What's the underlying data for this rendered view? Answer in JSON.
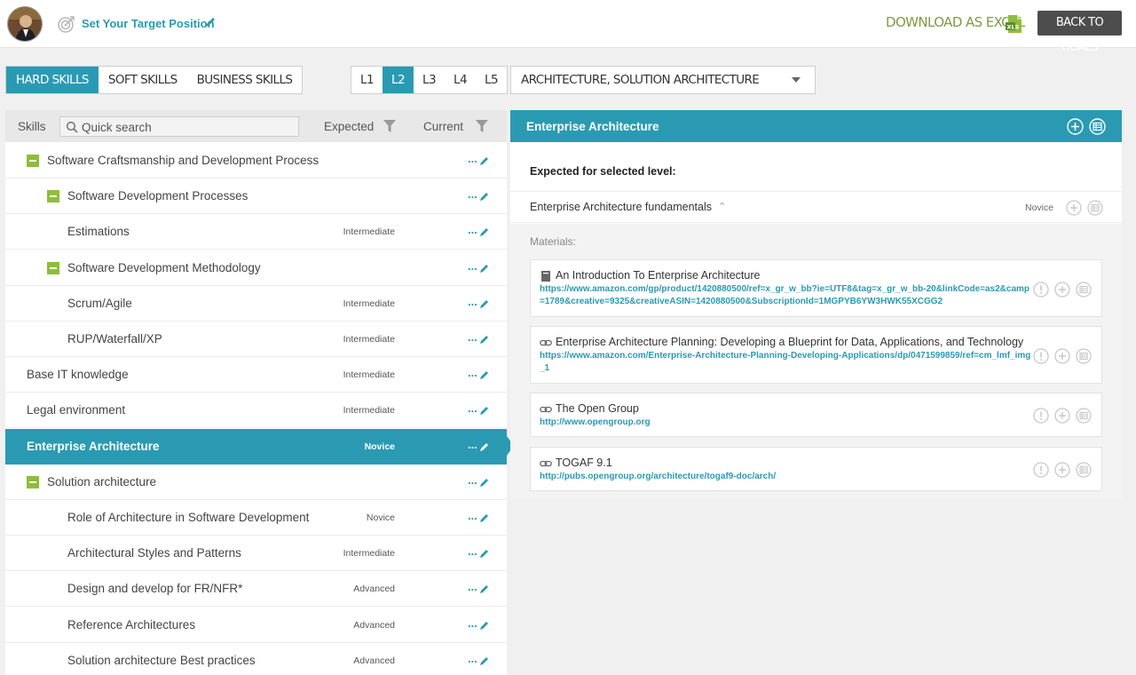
{
  "header": {
    "target_label": "Set Your Target Position",
    "download_label": "DOWNLOAD AS EXCEL",
    "back_label": "BACK TO GOALS"
  },
  "skill_tabs": [
    {
      "label": "HARD SKILLS",
      "active": true
    },
    {
      "label": "SOFT SKILLS",
      "active": false
    },
    {
      "label": "BUSINESS SKILLS",
      "active": false
    }
  ],
  "level_tabs": [
    {
      "label": "L1",
      "active": false
    },
    {
      "label": "L2",
      "active": true
    },
    {
      "label": "L3",
      "active": false
    },
    {
      "label": "L4",
      "active": false
    },
    {
      "label": "L5",
      "active": false
    }
  ],
  "area_select": {
    "value": "ARCHITECTURE, SOLUTION ARCHITECTURE"
  },
  "left_panel": {
    "skills_header": "Skills",
    "search_placeholder": "Quick search",
    "expected_header": "Expected",
    "current_header": "Current"
  },
  "skills": [
    {
      "name": "Software Craftsmanship and Development Process",
      "level": "",
      "indent": 1,
      "collapse": true,
      "bold": false,
      "selected": false
    },
    {
      "name": "Software Development Processes",
      "level": "",
      "indent": 2,
      "collapse": true,
      "bold": false,
      "selected": false
    },
    {
      "name": "Estimations",
      "level": "Intermediate",
      "indent": 3,
      "collapse": false,
      "bold": false,
      "selected": false
    },
    {
      "name": "Software Development Methodology",
      "level": "",
      "indent": 2,
      "collapse": true,
      "bold": false,
      "selected": false
    },
    {
      "name": "Scrum/Agile",
      "level": "Intermediate",
      "indent": 3,
      "collapse": false,
      "bold": false,
      "selected": false
    },
    {
      "name": "RUP/Waterfall/XP",
      "level": "Intermediate",
      "indent": 3,
      "collapse": false,
      "bold": false,
      "selected": false
    },
    {
      "name": "Base IT knowledge",
      "level": "Intermediate",
      "indent": 0,
      "collapse": false,
      "bold": false,
      "selected": false
    },
    {
      "name": "Legal environment",
      "level": "Intermediate",
      "indent": 0,
      "collapse": false,
      "bold": false,
      "selected": false
    },
    {
      "name": "Enterprise Architecture",
      "level": "Novice",
      "indent": 0,
      "collapse": false,
      "bold": true,
      "selected": true
    },
    {
      "name": "Solution architecture",
      "level": "",
      "indent": 1,
      "collapse": true,
      "bold": false,
      "selected": false
    },
    {
      "name": "Role of Architecture in Software Development",
      "level": "Novice",
      "indent": 2,
      "collapse": false,
      "bold": false,
      "selected": false
    },
    {
      "name": "Architectural Styles and Patterns",
      "level": "Intermediate",
      "indent": 2,
      "collapse": false,
      "bold": false,
      "selected": false
    },
    {
      "name": "Design and develop for FR/NFR*",
      "level": "Advanced",
      "indent": 2,
      "collapse": false,
      "bold": false,
      "selected": false
    },
    {
      "name": "Reference Architectures",
      "level": "Advanced",
      "indent": 2,
      "collapse": false,
      "bold": false,
      "selected": false
    },
    {
      "name": "Solution architecture Best practices",
      "level": "Advanced",
      "indent": 2,
      "collapse": false,
      "bold": false,
      "selected": false
    }
  ],
  "row_dots": "...",
  "detail": {
    "title": "Enterprise Architecture",
    "expected_label": "Expected for selected level:",
    "fundamentals": {
      "name": "Enterprise Architecture fundamentals",
      "level": "Novice"
    },
    "materials_label": "Materials:",
    "materials": [
      {
        "icon": "book-icon",
        "title": "An Introduction To Enterprise Architecture",
        "url": "https://www.amazon.com/gp/product/1420880500/ref=x_gr_w_bb?ie=UTF8&tag=x_gr_w_bb-20&linkCode=as2&camp=1789&creative=9325&creativeASIN=1420880500&SubscriptionId=1MGPYB6YW3HWK55XCGG2"
      },
      {
        "icon": "link-icon",
        "title": "Enterprise Architecture Planning: Developing a Blueprint for Data, Applications, and Technology",
        "url": "https://www.amazon.com/Enterprise-Architecture-Planning-Developing-Applications/dp/0471599859/ref=cm_lmf_img_1"
      },
      {
        "icon": "link-icon",
        "title": "The Open Group",
        "url": "http://www.opengroup.org"
      },
      {
        "icon": "link-icon",
        "title": "TOGAF 9.1",
        "url": "http://pubs.opengroup.org/architecture/togaf9-doc/arch/"
      }
    ]
  },
  "colors": {
    "accent": "#2a9ab3",
    "green": "#8dbe3a",
    "excel": "#7d9c42",
    "dark_button": "#4d4d4d"
  }
}
